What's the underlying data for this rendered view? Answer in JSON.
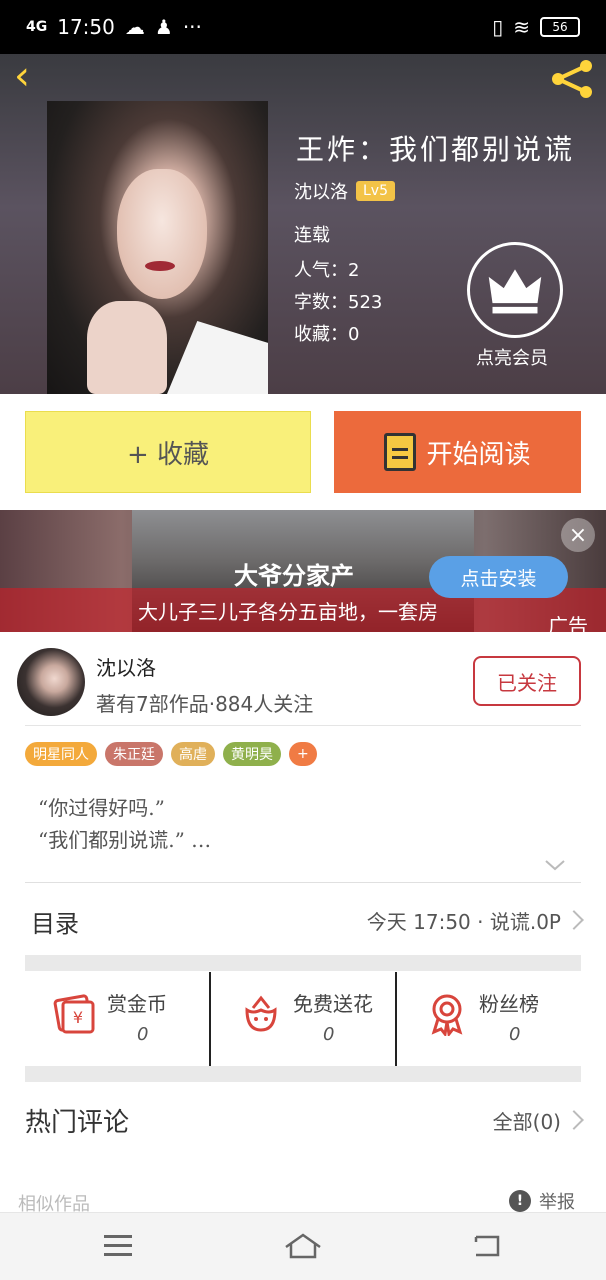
{
  "status_bar": {
    "network": "4G",
    "time": "17:50",
    "more": "···",
    "battery": "56"
  },
  "book": {
    "title": "王炸：我们都别说谎",
    "author": "沈以洛",
    "level": "Lv5",
    "status": "连载",
    "popularity": "人气：2",
    "word_count": "字数：523",
    "collections": "收藏：0"
  },
  "vip": {
    "label": "点亮会员",
    "icon": "crown-icon"
  },
  "buttons": {
    "collect": "+ 收藏",
    "read": "开始阅读"
  },
  "ad": {
    "title": "大爷分家产",
    "subtitle": "大儿子三儿子各分五亩地，一套房",
    "install": "点击安装",
    "close": "×",
    "label": "广告"
  },
  "author_card": {
    "name": "沈以洛",
    "stats": "著有7部作品·884人关注",
    "follow": "已关注"
  },
  "tags": [
    {
      "label": "明星同人",
      "color": "#f3a93b"
    },
    {
      "label": "朱正廷",
      "color": "#c9766a"
    },
    {
      "label": "高虐",
      "color": "#e0b05a"
    },
    {
      "label": "黄明昊",
      "color": "#8fb04c"
    },
    {
      "label": "+",
      "color": "#f07b44"
    }
  ],
  "synopsis": {
    "line1": "“你过得好吗.”",
    "line2": "“我们都别说谎.”  …"
  },
  "toc": {
    "label": "目录",
    "latest": "今天 17:50 · 说谎.0P"
  },
  "actions": [
    {
      "label": "赏金币",
      "count": "0",
      "icon": "red-envelope-icon"
    },
    {
      "label": "免费送花",
      "count": "0",
      "icon": "flower-icon"
    },
    {
      "label": "粉丝榜",
      "count": "0",
      "icon": "medal-icon"
    }
  ],
  "comments": {
    "label": "热门评论",
    "all": "全部(0)"
  },
  "footer": {
    "similar": "相似作品",
    "report": "举报",
    "report_icon": "!"
  },
  "colors": {
    "accent_yellow": "#ffd43b",
    "read_orange": "#ec6a3c",
    "collect_yellow": "#f9f07a",
    "follow_red": "#c7383f"
  }
}
